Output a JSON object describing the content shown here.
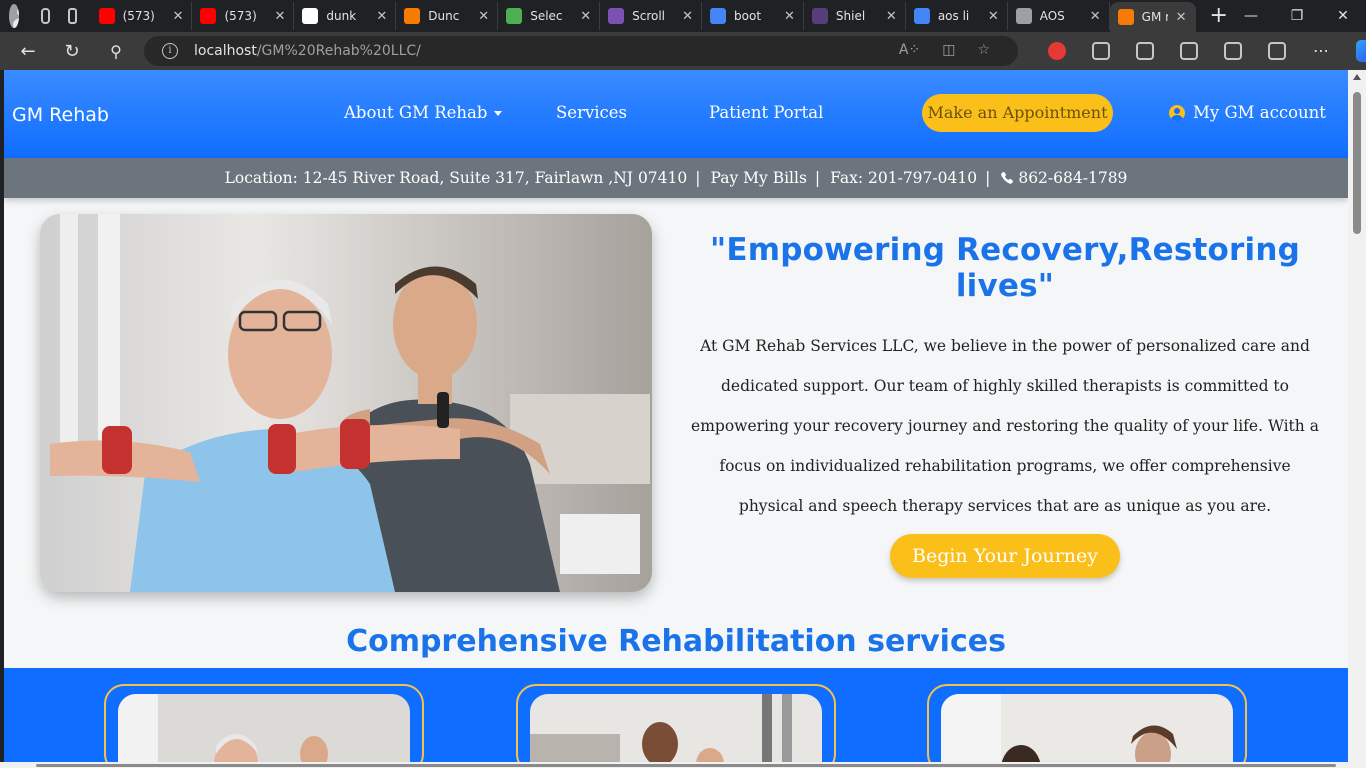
{
  "browser": {
    "tabs": [
      {
        "title": "(573)",
        "favicon": "youtube-icon",
        "color": "#ff0000"
      },
      {
        "title": "(573)",
        "favicon": "youtube-icon",
        "color": "#ff0000"
      },
      {
        "title": "dunk",
        "favicon": "github-icon",
        "color": "#ffffff"
      },
      {
        "title": "Dunc",
        "favicon": "app-icon",
        "color": "#f57c00"
      },
      {
        "title": "Selec",
        "favicon": "zoho-icon",
        "color": "#4caf50"
      },
      {
        "title": "Scroll",
        "favicon": "bootstrap-icon",
        "color": "#7952b3"
      },
      {
        "title": "boot",
        "favicon": "search-icon",
        "color": "#4285f4"
      },
      {
        "title": "Shiel",
        "favicon": "bootstrap-icon",
        "color": "#563d7c"
      },
      {
        "title": "aos li",
        "favicon": "search-icon",
        "color": "#4285f4"
      },
      {
        "title": "AOS",
        "favicon": "document-icon",
        "color": "#9aa0a6"
      },
      {
        "title": "GM r",
        "favicon": "app-icon",
        "color": "#f57c00",
        "active": true
      }
    ],
    "url_host": "localhost",
    "url_path": "/GM%20Rehab%20LLC/"
  },
  "nav": {
    "brand": "GM Rehab",
    "about": "About GM Rehab",
    "services": "Services",
    "portal": "Patient Portal",
    "appointment": "Make an Appointment",
    "account": "My GM account"
  },
  "info": {
    "location": "Location: 12-45 River Road, Suite 317, Fairlawn ,NJ 07410",
    "bills": "Pay My Bills",
    "fax": "Fax: 201-797-0410",
    "phone": "862-684-1789",
    "separator": "|"
  },
  "hero": {
    "title": "\"Empowering Recovery,Restoring lives\"",
    "text": "At GM Rehab Services LLC, we believe in the power of personalized care and dedicated support. Our team of highly skilled therapists is committed to empowering your recovery journey and restoring the quality of your life. With a focus on individualized rehabilitation programs, we offer comprehensive physical and speech therapy services that are as unique as you are.",
    "button": "Begin Your Journey"
  },
  "services": {
    "title": "Comprehensive Rehabilitation services"
  },
  "colors": {
    "primary": "#0f6dff",
    "accent": "#fbbf1a",
    "heading": "#1a73e8",
    "infobar": "#6c757d"
  }
}
